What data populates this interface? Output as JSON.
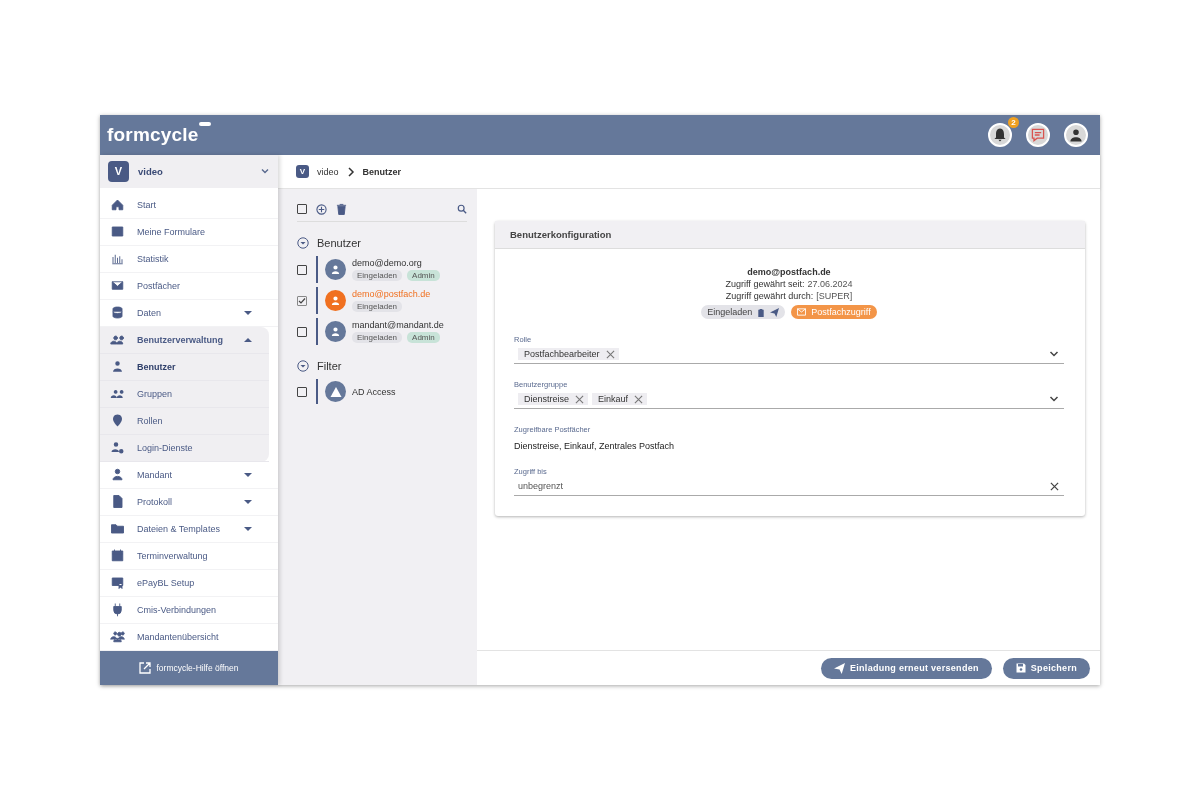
{
  "header": {
    "logo": "formcycle",
    "notifications": {
      "count": "2"
    }
  },
  "sidebar": {
    "tenant": {
      "initial": "V",
      "name": "video"
    },
    "items": [
      {
        "label": "Start",
        "kind": "link"
      },
      {
        "label": "Meine Formulare",
        "kind": "link"
      },
      {
        "label": "Statistik",
        "kind": "link"
      },
      {
        "label": "Postfächer",
        "kind": "link"
      },
      {
        "label": "Daten",
        "kind": "menu",
        "expanded": false
      },
      {
        "label": "Benutzerverwaltung",
        "kind": "menu",
        "expanded": true,
        "children": [
          {
            "label": "Benutzer",
            "selected": true
          },
          {
            "label": "Gruppen",
            "selected": false
          },
          {
            "label": "Rollen",
            "selected": false
          },
          {
            "label": "Login-Dienste",
            "selected": false
          }
        ]
      },
      {
        "label": "Mandant",
        "kind": "menu",
        "expanded": false
      },
      {
        "label": "Protokoll",
        "kind": "menu",
        "expanded": false
      },
      {
        "label": "Dateien & Templates",
        "kind": "menu",
        "expanded": false
      },
      {
        "label": "Terminverwaltung",
        "kind": "link"
      },
      {
        "label": "ePayBL Setup",
        "kind": "link"
      },
      {
        "label": "Cmis-Verbindungen",
        "kind": "link"
      },
      {
        "label": "Mandantenübersicht",
        "kind": "link"
      }
    ],
    "help_link": "formcycle-Hilfe öffnen"
  },
  "breadcrumb": {
    "initial": "V",
    "items": [
      "video",
      "Benutzer"
    ]
  },
  "user_list": {
    "select_all_checked": false,
    "groups": [
      {
        "title": "Benutzer",
        "expanded": true,
        "entries": [
          {
            "kind": "user",
            "name": "demo@demo.org",
            "checked": false,
            "selected": false,
            "tags": [
              {
                "label": "Eingeladen",
                "kind": "status"
              },
              {
                "label": "Admin",
                "kind": "role"
              }
            ]
          },
          {
            "kind": "user",
            "name": "demo@postfach.de",
            "checked": true,
            "selected": true,
            "tags": [
              {
                "label": "Eingeladen",
                "kind": "status"
              }
            ]
          },
          {
            "kind": "user",
            "name": "mandant@mandant.de",
            "checked": false,
            "selected": false,
            "tags": [
              {
                "label": "Eingeladen",
                "kind": "status"
              },
              {
                "label": "Admin",
                "kind": "role"
              }
            ]
          }
        ]
      },
      {
        "title": "Filter",
        "expanded": true,
        "entries": [
          {
            "kind": "filter",
            "name": "AD Access",
            "checked": false,
            "selected": false
          }
        ]
      }
    ]
  },
  "config": {
    "title": "Benutzerkonfiguration",
    "email": "demo@postfach.de",
    "info": [
      {
        "label": "Zugriff gewährt seit:",
        "value": "27.06.2024"
      },
      {
        "label": "Zugriff gewährt durch:",
        "value": "[SUPER]"
      }
    ],
    "badges": [
      {
        "label": "Eingeladen",
        "kind": "status"
      },
      {
        "label": "Postfachzugriff",
        "kind": "mailbox"
      }
    ],
    "fields": [
      {
        "kind": "select",
        "label": "Rolle",
        "chips": [
          "Postfachbearbeiter"
        ]
      },
      {
        "kind": "select",
        "label": "Benutzergruppe",
        "chips": [
          "Dienstreise",
          "Einkauf"
        ]
      },
      {
        "kind": "text",
        "label": "Zugreifbare Postfächer",
        "value": "Dienstreise, Einkauf, Zentrales Postfach"
      },
      {
        "kind": "input",
        "label": "Zugriff bis",
        "value": "unbegrenzt"
      }
    ]
  },
  "actions": [
    {
      "label": "Einladung erneut versenden",
      "kind": "send"
    },
    {
      "label": "Speichern",
      "kind": "save"
    }
  ]
}
